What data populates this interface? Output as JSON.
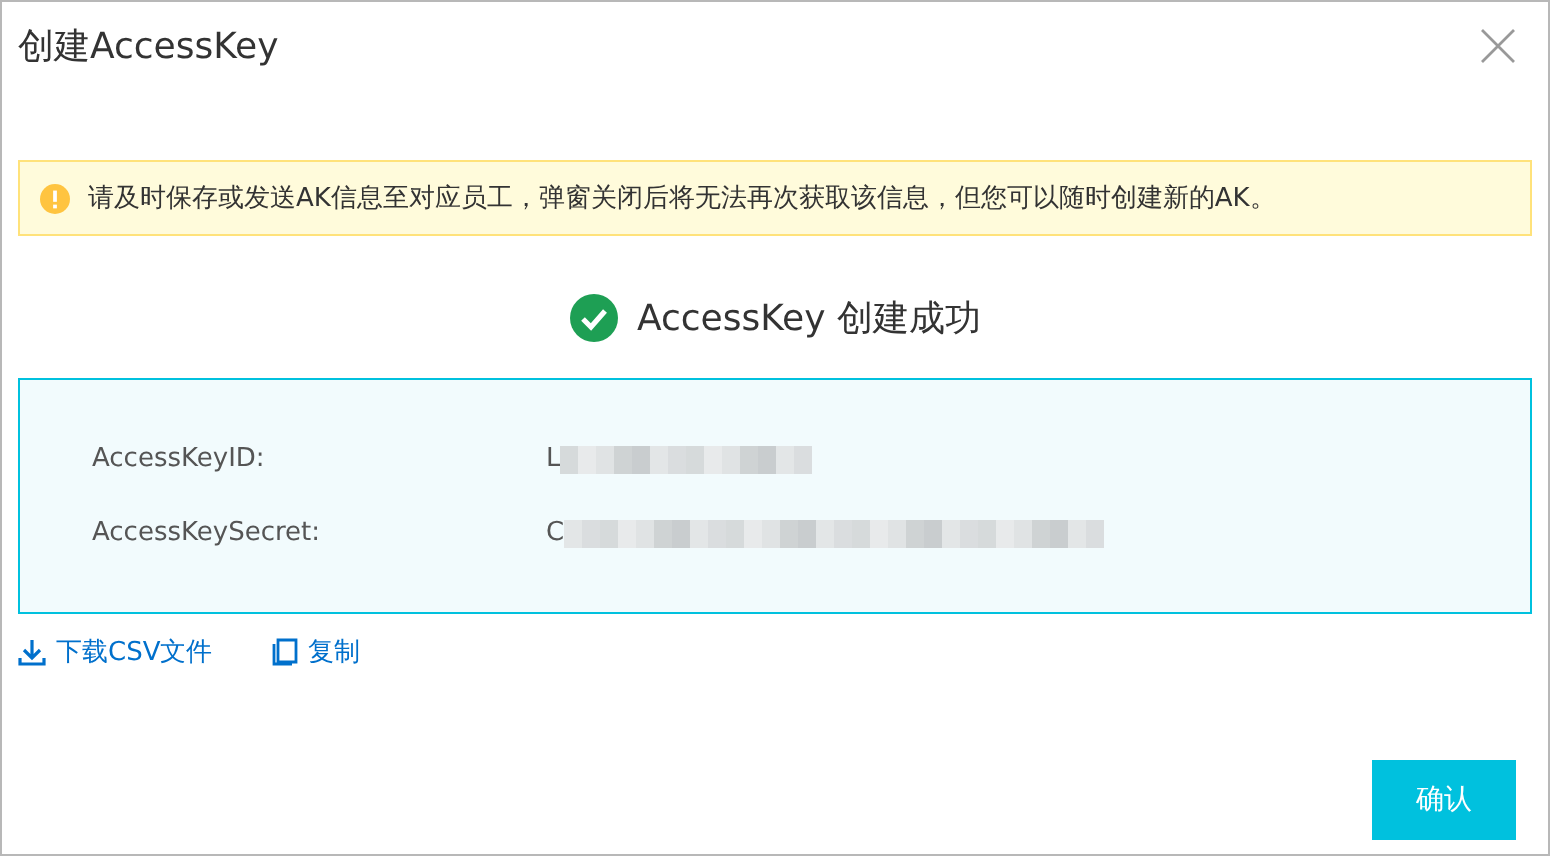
{
  "dialog": {
    "title": "创建AccessKey"
  },
  "alert": {
    "text": "请及时保存或发送AK信息至对应员工，弹窗关闭后将无法再次获取该信息，但您可以随时创建新的AK。"
  },
  "result": {
    "text": "AccessKey 创建成功"
  },
  "fields": [
    {
      "label": "AccessKeyID:",
      "value": "L"
    },
    {
      "label": "AccessKeySecret:",
      "value": "C"
    }
  ],
  "links": [
    {
      "kind": "download",
      "label": "下载CSV文件"
    },
    {
      "kind": "copy",
      "label": "复制"
    }
  ],
  "buttons": [
    {
      "label": "确认"
    }
  ]
}
